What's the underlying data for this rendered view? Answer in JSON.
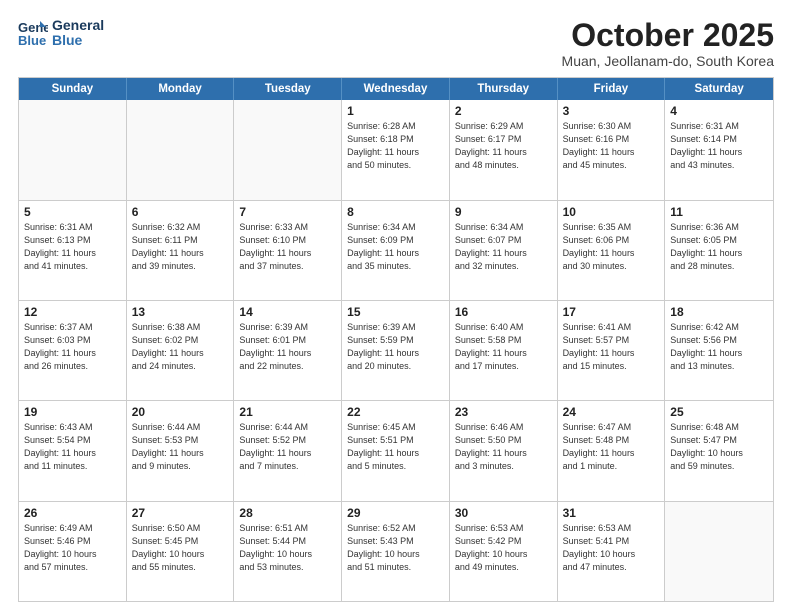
{
  "header": {
    "logo_line1": "General",
    "logo_line2": "Blue",
    "month": "October 2025",
    "location": "Muan, Jeollanam-do, South Korea"
  },
  "days_of_week": [
    "Sunday",
    "Monday",
    "Tuesday",
    "Wednesday",
    "Thursday",
    "Friday",
    "Saturday"
  ],
  "weeks": [
    [
      {
        "day": "",
        "empty": true
      },
      {
        "day": "",
        "empty": true
      },
      {
        "day": "",
        "empty": true
      },
      {
        "day": "1",
        "line1": "Sunrise: 6:28 AM",
        "line2": "Sunset: 6:18 PM",
        "line3": "Daylight: 11 hours",
        "line4": "and 50 minutes."
      },
      {
        "day": "2",
        "line1": "Sunrise: 6:29 AM",
        "line2": "Sunset: 6:17 PM",
        "line3": "Daylight: 11 hours",
        "line4": "and 48 minutes."
      },
      {
        "day": "3",
        "line1": "Sunrise: 6:30 AM",
        "line2": "Sunset: 6:16 PM",
        "line3": "Daylight: 11 hours",
        "line4": "and 45 minutes."
      },
      {
        "day": "4",
        "line1": "Sunrise: 6:31 AM",
        "line2": "Sunset: 6:14 PM",
        "line3": "Daylight: 11 hours",
        "line4": "and 43 minutes."
      }
    ],
    [
      {
        "day": "5",
        "line1": "Sunrise: 6:31 AM",
        "line2": "Sunset: 6:13 PM",
        "line3": "Daylight: 11 hours",
        "line4": "and 41 minutes."
      },
      {
        "day": "6",
        "line1": "Sunrise: 6:32 AM",
        "line2": "Sunset: 6:11 PM",
        "line3": "Daylight: 11 hours",
        "line4": "and 39 minutes."
      },
      {
        "day": "7",
        "line1": "Sunrise: 6:33 AM",
        "line2": "Sunset: 6:10 PM",
        "line3": "Daylight: 11 hours",
        "line4": "and 37 minutes."
      },
      {
        "day": "8",
        "line1": "Sunrise: 6:34 AM",
        "line2": "Sunset: 6:09 PM",
        "line3": "Daylight: 11 hours",
        "line4": "and 35 minutes."
      },
      {
        "day": "9",
        "line1": "Sunrise: 6:34 AM",
        "line2": "Sunset: 6:07 PM",
        "line3": "Daylight: 11 hours",
        "line4": "and 32 minutes."
      },
      {
        "day": "10",
        "line1": "Sunrise: 6:35 AM",
        "line2": "Sunset: 6:06 PM",
        "line3": "Daylight: 11 hours",
        "line4": "and 30 minutes."
      },
      {
        "day": "11",
        "line1": "Sunrise: 6:36 AM",
        "line2": "Sunset: 6:05 PM",
        "line3": "Daylight: 11 hours",
        "line4": "and 28 minutes."
      }
    ],
    [
      {
        "day": "12",
        "line1": "Sunrise: 6:37 AM",
        "line2": "Sunset: 6:03 PM",
        "line3": "Daylight: 11 hours",
        "line4": "and 26 minutes."
      },
      {
        "day": "13",
        "line1": "Sunrise: 6:38 AM",
        "line2": "Sunset: 6:02 PM",
        "line3": "Daylight: 11 hours",
        "line4": "and 24 minutes."
      },
      {
        "day": "14",
        "line1": "Sunrise: 6:39 AM",
        "line2": "Sunset: 6:01 PM",
        "line3": "Daylight: 11 hours",
        "line4": "and 22 minutes."
      },
      {
        "day": "15",
        "line1": "Sunrise: 6:39 AM",
        "line2": "Sunset: 5:59 PM",
        "line3": "Daylight: 11 hours",
        "line4": "and 20 minutes."
      },
      {
        "day": "16",
        "line1": "Sunrise: 6:40 AM",
        "line2": "Sunset: 5:58 PM",
        "line3": "Daylight: 11 hours",
        "line4": "and 17 minutes."
      },
      {
        "day": "17",
        "line1": "Sunrise: 6:41 AM",
        "line2": "Sunset: 5:57 PM",
        "line3": "Daylight: 11 hours",
        "line4": "and 15 minutes."
      },
      {
        "day": "18",
        "line1": "Sunrise: 6:42 AM",
        "line2": "Sunset: 5:56 PM",
        "line3": "Daylight: 11 hours",
        "line4": "and 13 minutes."
      }
    ],
    [
      {
        "day": "19",
        "line1": "Sunrise: 6:43 AM",
        "line2": "Sunset: 5:54 PM",
        "line3": "Daylight: 11 hours",
        "line4": "and 11 minutes."
      },
      {
        "day": "20",
        "line1": "Sunrise: 6:44 AM",
        "line2": "Sunset: 5:53 PM",
        "line3": "Daylight: 11 hours",
        "line4": "and 9 minutes."
      },
      {
        "day": "21",
        "line1": "Sunrise: 6:44 AM",
        "line2": "Sunset: 5:52 PM",
        "line3": "Daylight: 11 hours",
        "line4": "and 7 minutes."
      },
      {
        "day": "22",
        "line1": "Sunrise: 6:45 AM",
        "line2": "Sunset: 5:51 PM",
        "line3": "Daylight: 11 hours",
        "line4": "and 5 minutes."
      },
      {
        "day": "23",
        "line1": "Sunrise: 6:46 AM",
        "line2": "Sunset: 5:50 PM",
        "line3": "Daylight: 11 hours",
        "line4": "and 3 minutes."
      },
      {
        "day": "24",
        "line1": "Sunrise: 6:47 AM",
        "line2": "Sunset: 5:48 PM",
        "line3": "Daylight: 11 hours",
        "line4": "and 1 minute."
      },
      {
        "day": "25",
        "line1": "Sunrise: 6:48 AM",
        "line2": "Sunset: 5:47 PM",
        "line3": "Daylight: 10 hours",
        "line4": "and 59 minutes."
      }
    ],
    [
      {
        "day": "26",
        "line1": "Sunrise: 6:49 AM",
        "line2": "Sunset: 5:46 PM",
        "line3": "Daylight: 10 hours",
        "line4": "and 57 minutes."
      },
      {
        "day": "27",
        "line1": "Sunrise: 6:50 AM",
        "line2": "Sunset: 5:45 PM",
        "line3": "Daylight: 10 hours",
        "line4": "and 55 minutes."
      },
      {
        "day": "28",
        "line1": "Sunrise: 6:51 AM",
        "line2": "Sunset: 5:44 PM",
        "line3": "Daylight: 10 hours",
        "line4": "and 53 minutes."
      },
      {
        "day": "29",
        "line1": "Sunrise: 6:52 AM",
        "line2": "Sunset: 5:43 PM",
        "line3": "Daylight: 10 hours",
        "line4": "and 51 minutes."
      },
      {
        "day": "30",
        "line1": "Sunrise: 6:53 AM",
        "line2": "Sunset: 5:42 PM",
        "line3": "Daylight: 10 hours",
        "line4": "and 49 minutes."
      },
      {
        "day": "31",
        "line1": "Sunrise: 6:53 AM",
        "line2": "Sunset: 5:41 PM",
        "line3": "Daylight: 10 hours",
        "line4": "and 47 minutes."
      },
      {
        "day": "",
        "empty": true
      }
    ]
  ]
}
